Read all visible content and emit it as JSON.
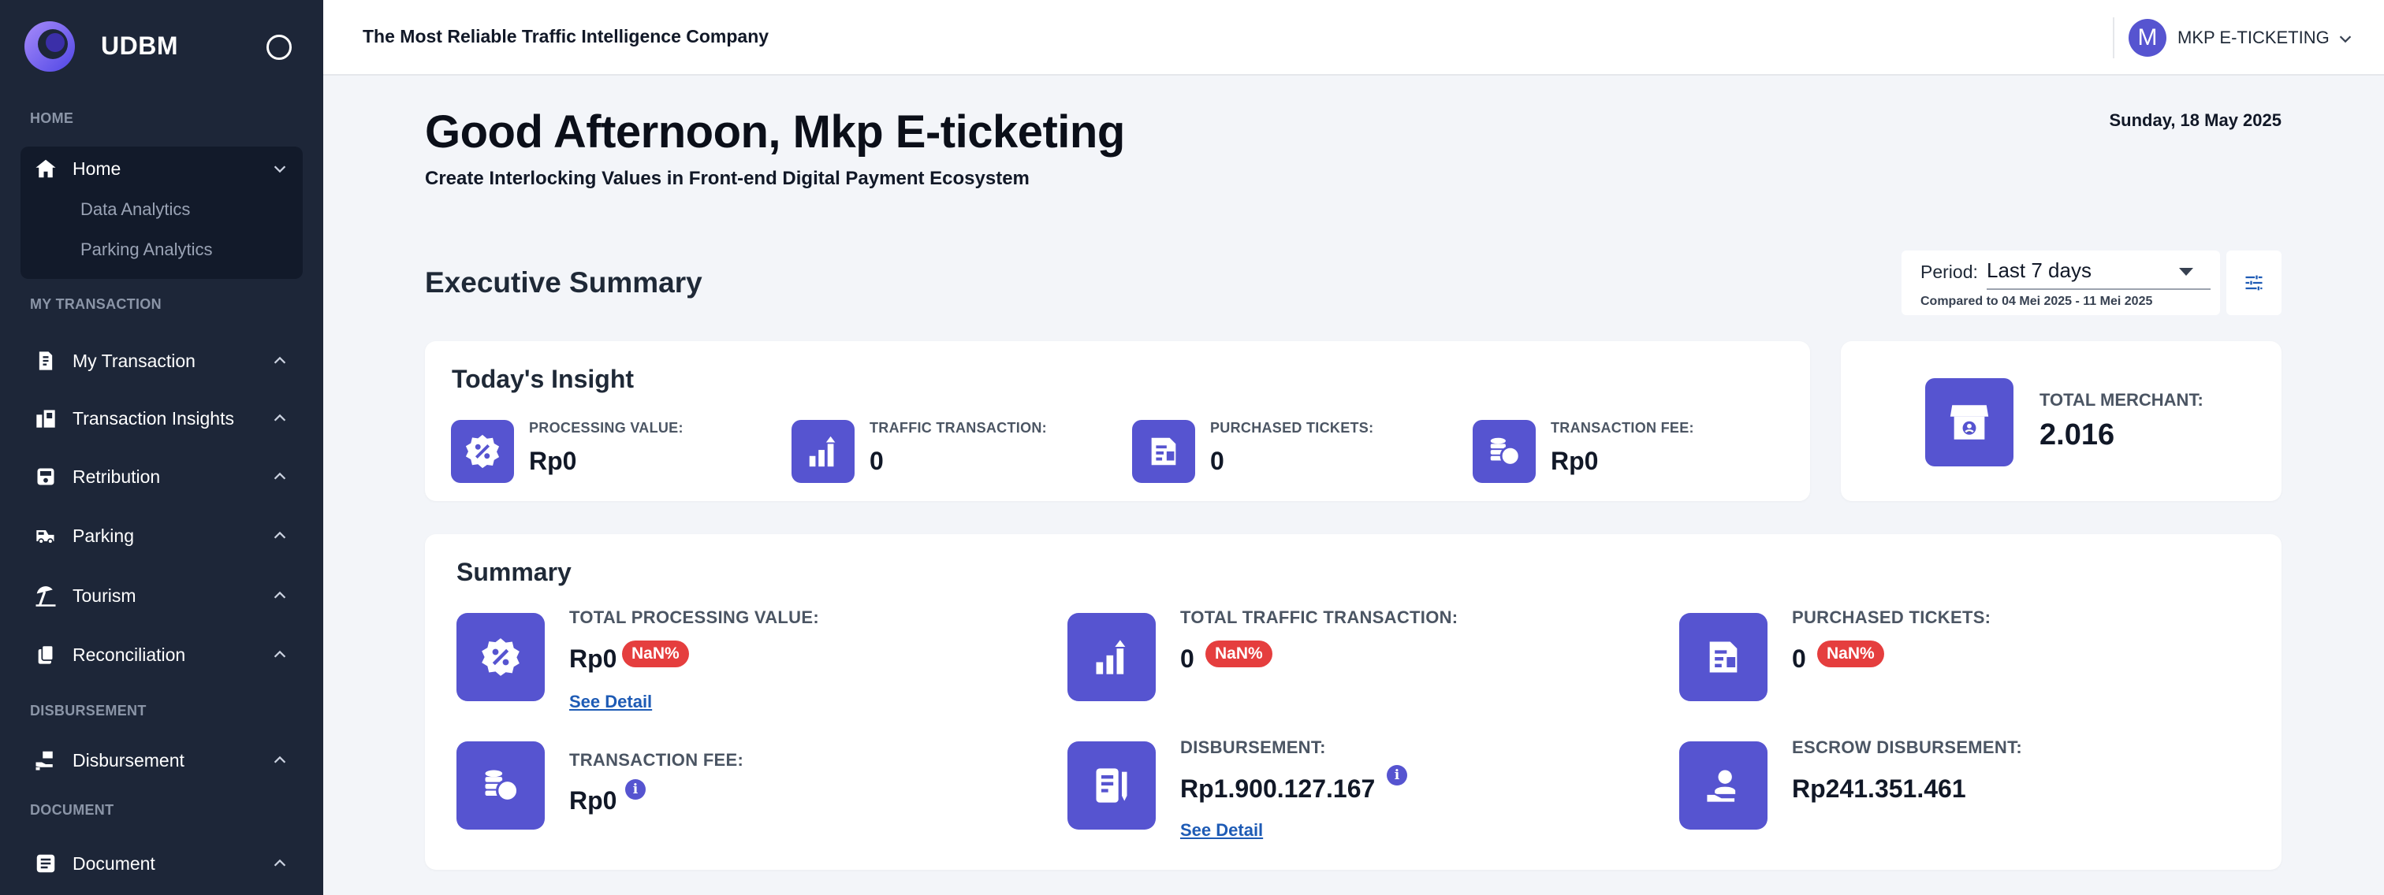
{
  "brand": {
    "name": "UDBM"
  },
  "sidebar": {
    "sections": {
      "home": "HOME",
      "my_transaction": "MY TRANSACTION",
      "disbursement": "DISBURSEMENT",
      "document": "DOCUMENT"
    },
    "home": {
      "label": "Home",
      "subitems": [
        "Data Analytics",
        "Parking Analytics"
      ]
    },
    "items": [
      {
        "label": "My Transaction",
        "icon": "receipt-icon"
      },
      {
        "label": "Transaction Insights",
        "icon": "insights-icon"
      },
      {
        "label": "Retribution",
        "icon": "retribution-icon"
      },
      {
        "label": "Parking",
        "icon": "car-icon"
      },
      {
        "label": "Tourism",
        "icon": "beach-icon"
      },
      {
        "label": "Reconciliation",
        "icon": "reconciliation-icon"
      },
      {
        "label": "Disbursement",
        "icon": "hand-coin-icon"
      },
      {
        "label": "Document",
        "icon": "document-icon"
      }
    ]
  },
  "topbar": {
    "company": "The Most Reliable Traffic Intelligence Company",
    "avatar_letter": "M",
    "user_name": "MKP E-TICKETING"
  },
  "main": {
    "greeting": "Good Afternoon, Mkp E-ticketing",
    "tagline": "Create Interlocking Values in Front-end Digital Payment Ecosystem",
    "date": "Sunday, 18 May 2025",
    "exec_title": "Executive Summary",
    "period": {
      "label": "Period:",
      "value": "Last 7 days",
      "compare": "Compared to 04 Mei 2025 - 11 Mei 2025"
    }
  },
  "insight": {
    "title": "Today's Insight",
    "items": [
      {
        "label": "PROCESSING VALUE:",
        "value": "Rp0",
        "icon": "percent-badge-icon"
      },
      {
        "label": "TRAFFIC TRANSACTION:",
        "value": "0",
        "icon": "growth-chart-icon"
      },
      {
        "label": "PURCHASED TICKETS:",
        "value": "0",
        "icon": "ticket-icon"
      },
      {
        "label": "TRANSACTION FEE:",
        "value": "Rp0",
        "icon": "coins-icon"
      }
    ]
  },
  "merchant": {
    "label": "TOTAL MERCHANT:",
    "value": "2.016",
    "icon": "store-icon"
  },
  "summary": {
    "title": "Summary",
    "items": [
      {
        "label": "TOTAL PROCESSING VALUE:",
        "value": "Rp0",
        "badge": "NaN%",
        "link": "See Detail"
      },
      {
        "label": "TOTAL TRAFFIC TRANSACTION:",
        "value": "0",
        "badge": "NaN%"
      },
      {
        "label": "PURCHASED TICKETS:",
        "value": "0",
        "badge": "NaN%"
      },
      {
        "label": "TRANSACTION FEE:",
        "value": "Rp0",
        "info": "i"
      },
      {
        "label": "DISBURSEMENT:",
        "value": "Rp1.900.127.167",
        "info": "i",
        "link": "See Detail"
      },
      {
        "label": "ESCROW DISBURSEMENT:",
        "value": "Rp241.351.461"
      }
    ]
  },
  "colors": {
    "sidebar_bg": "#1d2638",
    "accent": "#5654d0",
    "badge_red": "#e53e3e",
    "link": "#1e5bb5"
  }
}
